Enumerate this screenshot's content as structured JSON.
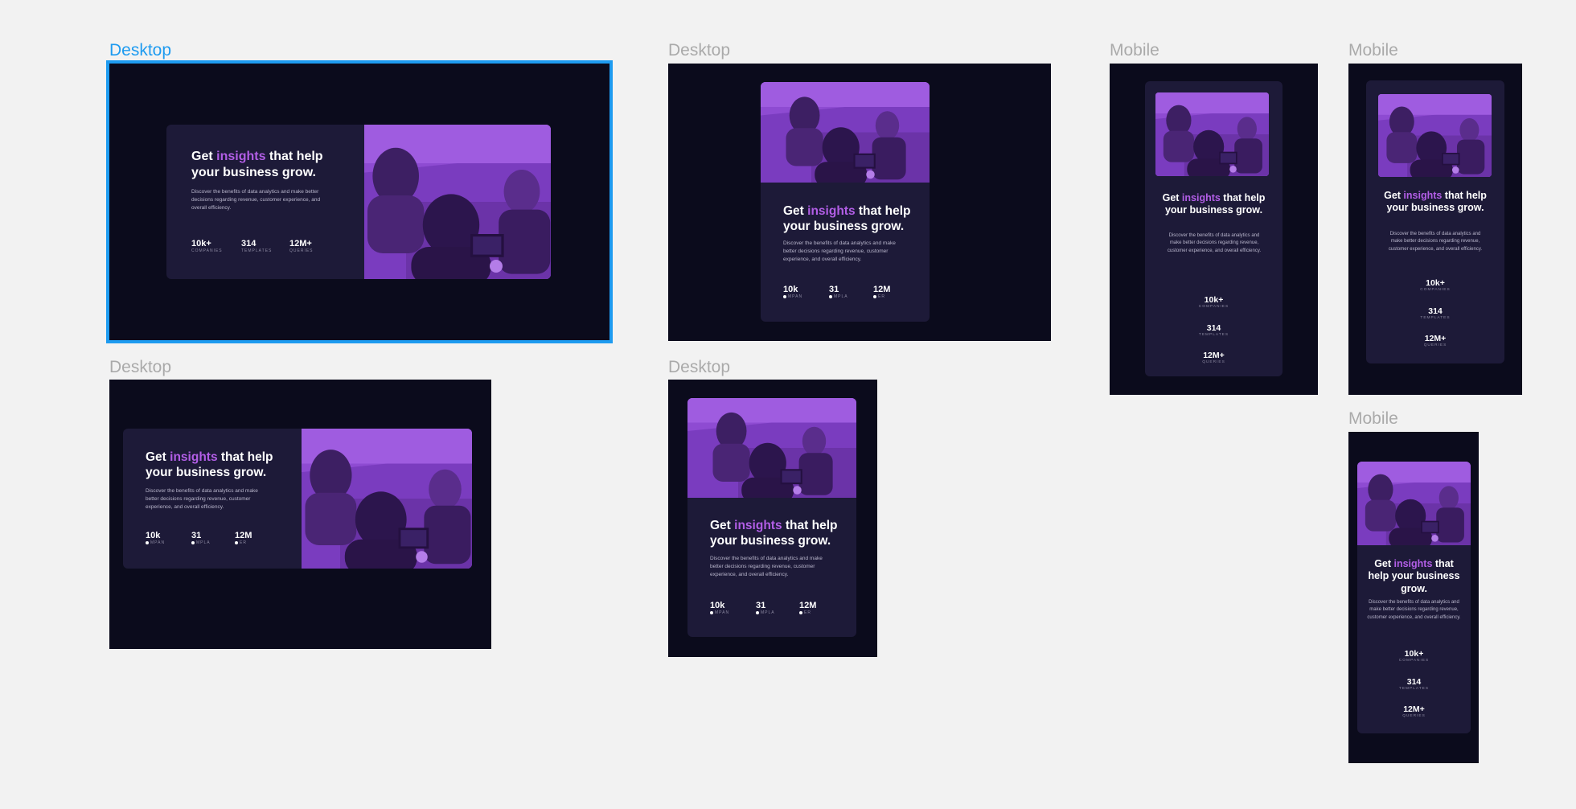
{
  "frames": {
    "desktop1": {
      "label": "Desktop"
    },
    "desktop2": {
      "label": "Desktop"
    },
    "desktop3": {
      "label": "Desktop"
    },
    "desktop4": {
      "label": "Desktop"
    },
    "mobile1": {
      "label": "Mobile"
    },
    "mobile2": {
      "label": "Mobile"
    },
    "mobile3": {
      "label": "Mobile"
    }
  },
  "card": {
    "title_get": "Get ",
    "title_highlight": "insights",
    "title_rest": " that help your business grow.",
    "description": "Discover the benefits of data analytics and make better decisions regarding revenue, customer experience, and overall efficiency.",
    "stats": [
      {
        "value": "10k+",
        "label": "COMPANIES"
      },
      {
        "value": "314",
        "label": "TEMPLATES"
      },
      {
        "value": "12M+",
        "label": "QUERIES"
      }
    ],
    "stats_truncated": [
      {
        "value": "10k",
        "label": "MPAN"
      },
      {
        "value": "31",
        "label": "MPLA"
      },
      {
        "value": "12M",
        "label": "ER"
      }
    ]
  },
  "colors": {
    "canvas": "#f2f2f2",
    "frame_bg": "#0b0b1c",
    "card_bg": "#1d1a38",
    "accent": "#b25ee6",
    "photo_tint": "#8e4bd2",
    "selection": "#1e9bf0"
  }
}
